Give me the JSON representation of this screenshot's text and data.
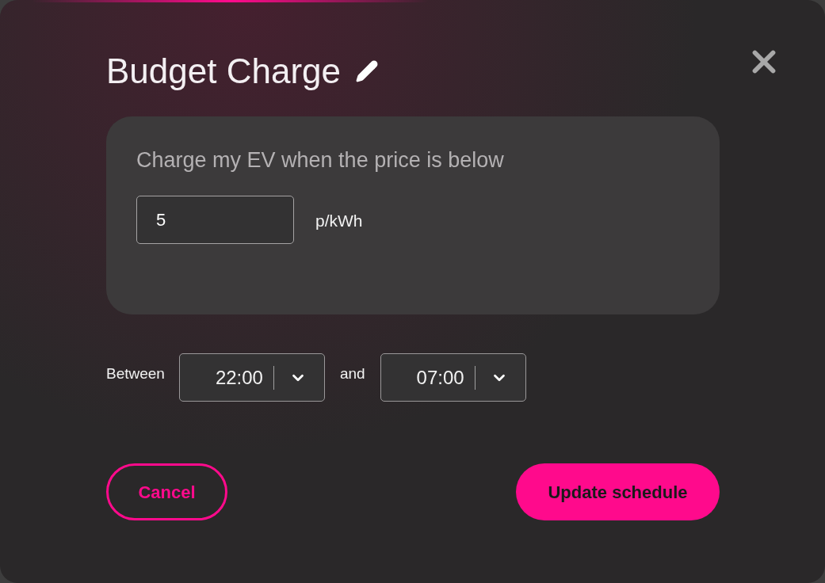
{
  "dialog": {
    "title": "Budget Charge"
  },
  "card": {
    "prompt": "Charge my EV when the price is below",
    "price_value": "5",
    "unit": "p/kWh"
  },
  "time_range": {
    "label_start": "Between",
    "start": "22:00",
    "label_join": "and",
    "end": "07:00"
  },
  "buttons": {
    "cancel": "Cancel",
    "submit": "Update schedule"
  }
}
